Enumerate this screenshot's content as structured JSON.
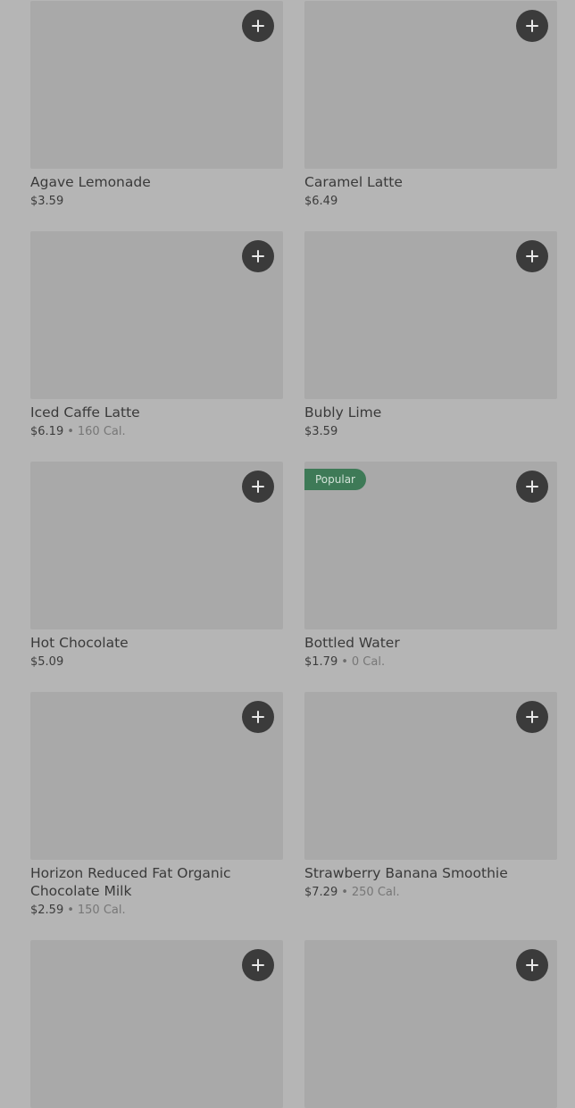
{
  "menu": {
    "items": [
      {
        "name": "Agave Lemonade",
        "price": "$3.59",
        "calories": ""
      },
      {
        "name": "Caramel Latte",
        "price": "$6.49",
        "calories": ""
      },
      {
        "name": "Iced Caffe Latte",
        "price": "$6.19",
        "calories": "160 Cal."
      },
      {
        "name": "Bubly Lime",
        "price": "$3.59",
        "calories": ""
      },
      {
        "name": "Hot Chocolate",
        "price": "$5.09",
        "calories": ""
      },
      {
        "name": "Bottled Water",
        "price": "$1.79",
        "calories": "0 Cal.",
        "badge": "Popular"
      },
      {
        "name": "Horizon Reduced Fat Organic Chocolate Milk",
        "price": "$2.59",
        "calories": "150 Cal."
      },
      {
        "name": "Strawberry Banana Smoothie",
        "price": "$7.29",
        "calories": "250 Cal."
      },
      {
        "name": "",
        "price": "",
        "calories": ""
      },
      {
        "name": "",
        "price": "",
        "calories": ""
      }
    ],
    "add_icon": "plus-icon",
    "separator": "•",
    "badge_color": "#3e7a57"
  }
}
